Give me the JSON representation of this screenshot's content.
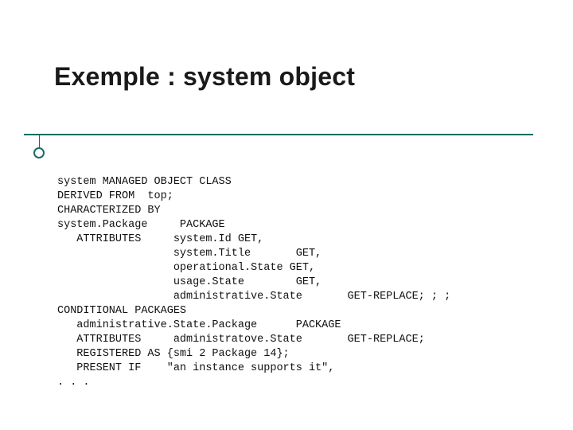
{
  "slide": {
    "title": "Exemple : system object",
    "code": {
      "l1": "system MANAGED OBJECT CLASS",
      "l2": "DERIVED FROM  top;",
      "l3": "CHARACTERIZED BY",
      "l4": "system.Package     PACKAGE",
      "l5": "   ATTRIBUTES     system.Id GET,",
      "l6": "                  system.Title       GET,",
      "l7": "                  operational.State GET,",
      "l8": "                  usage.State        GET,",
      "l9": "                  administrative.State       GET-REPLACE; ; ;",
      "l10": "CONDITIONAL PACKAGES",
      "l11": "   administrative.State.Package      PACKAGE",
      "l12": "   ATTRIBUTES     administratove.State       GET-REPLACE;",
      "l13": "   REGISTERED AS {smi 2 Package 14};",
      "l14": "   PRESENT IF    \"an instance supports it\",",
      "l15": ". . ."
    }
  }
}
